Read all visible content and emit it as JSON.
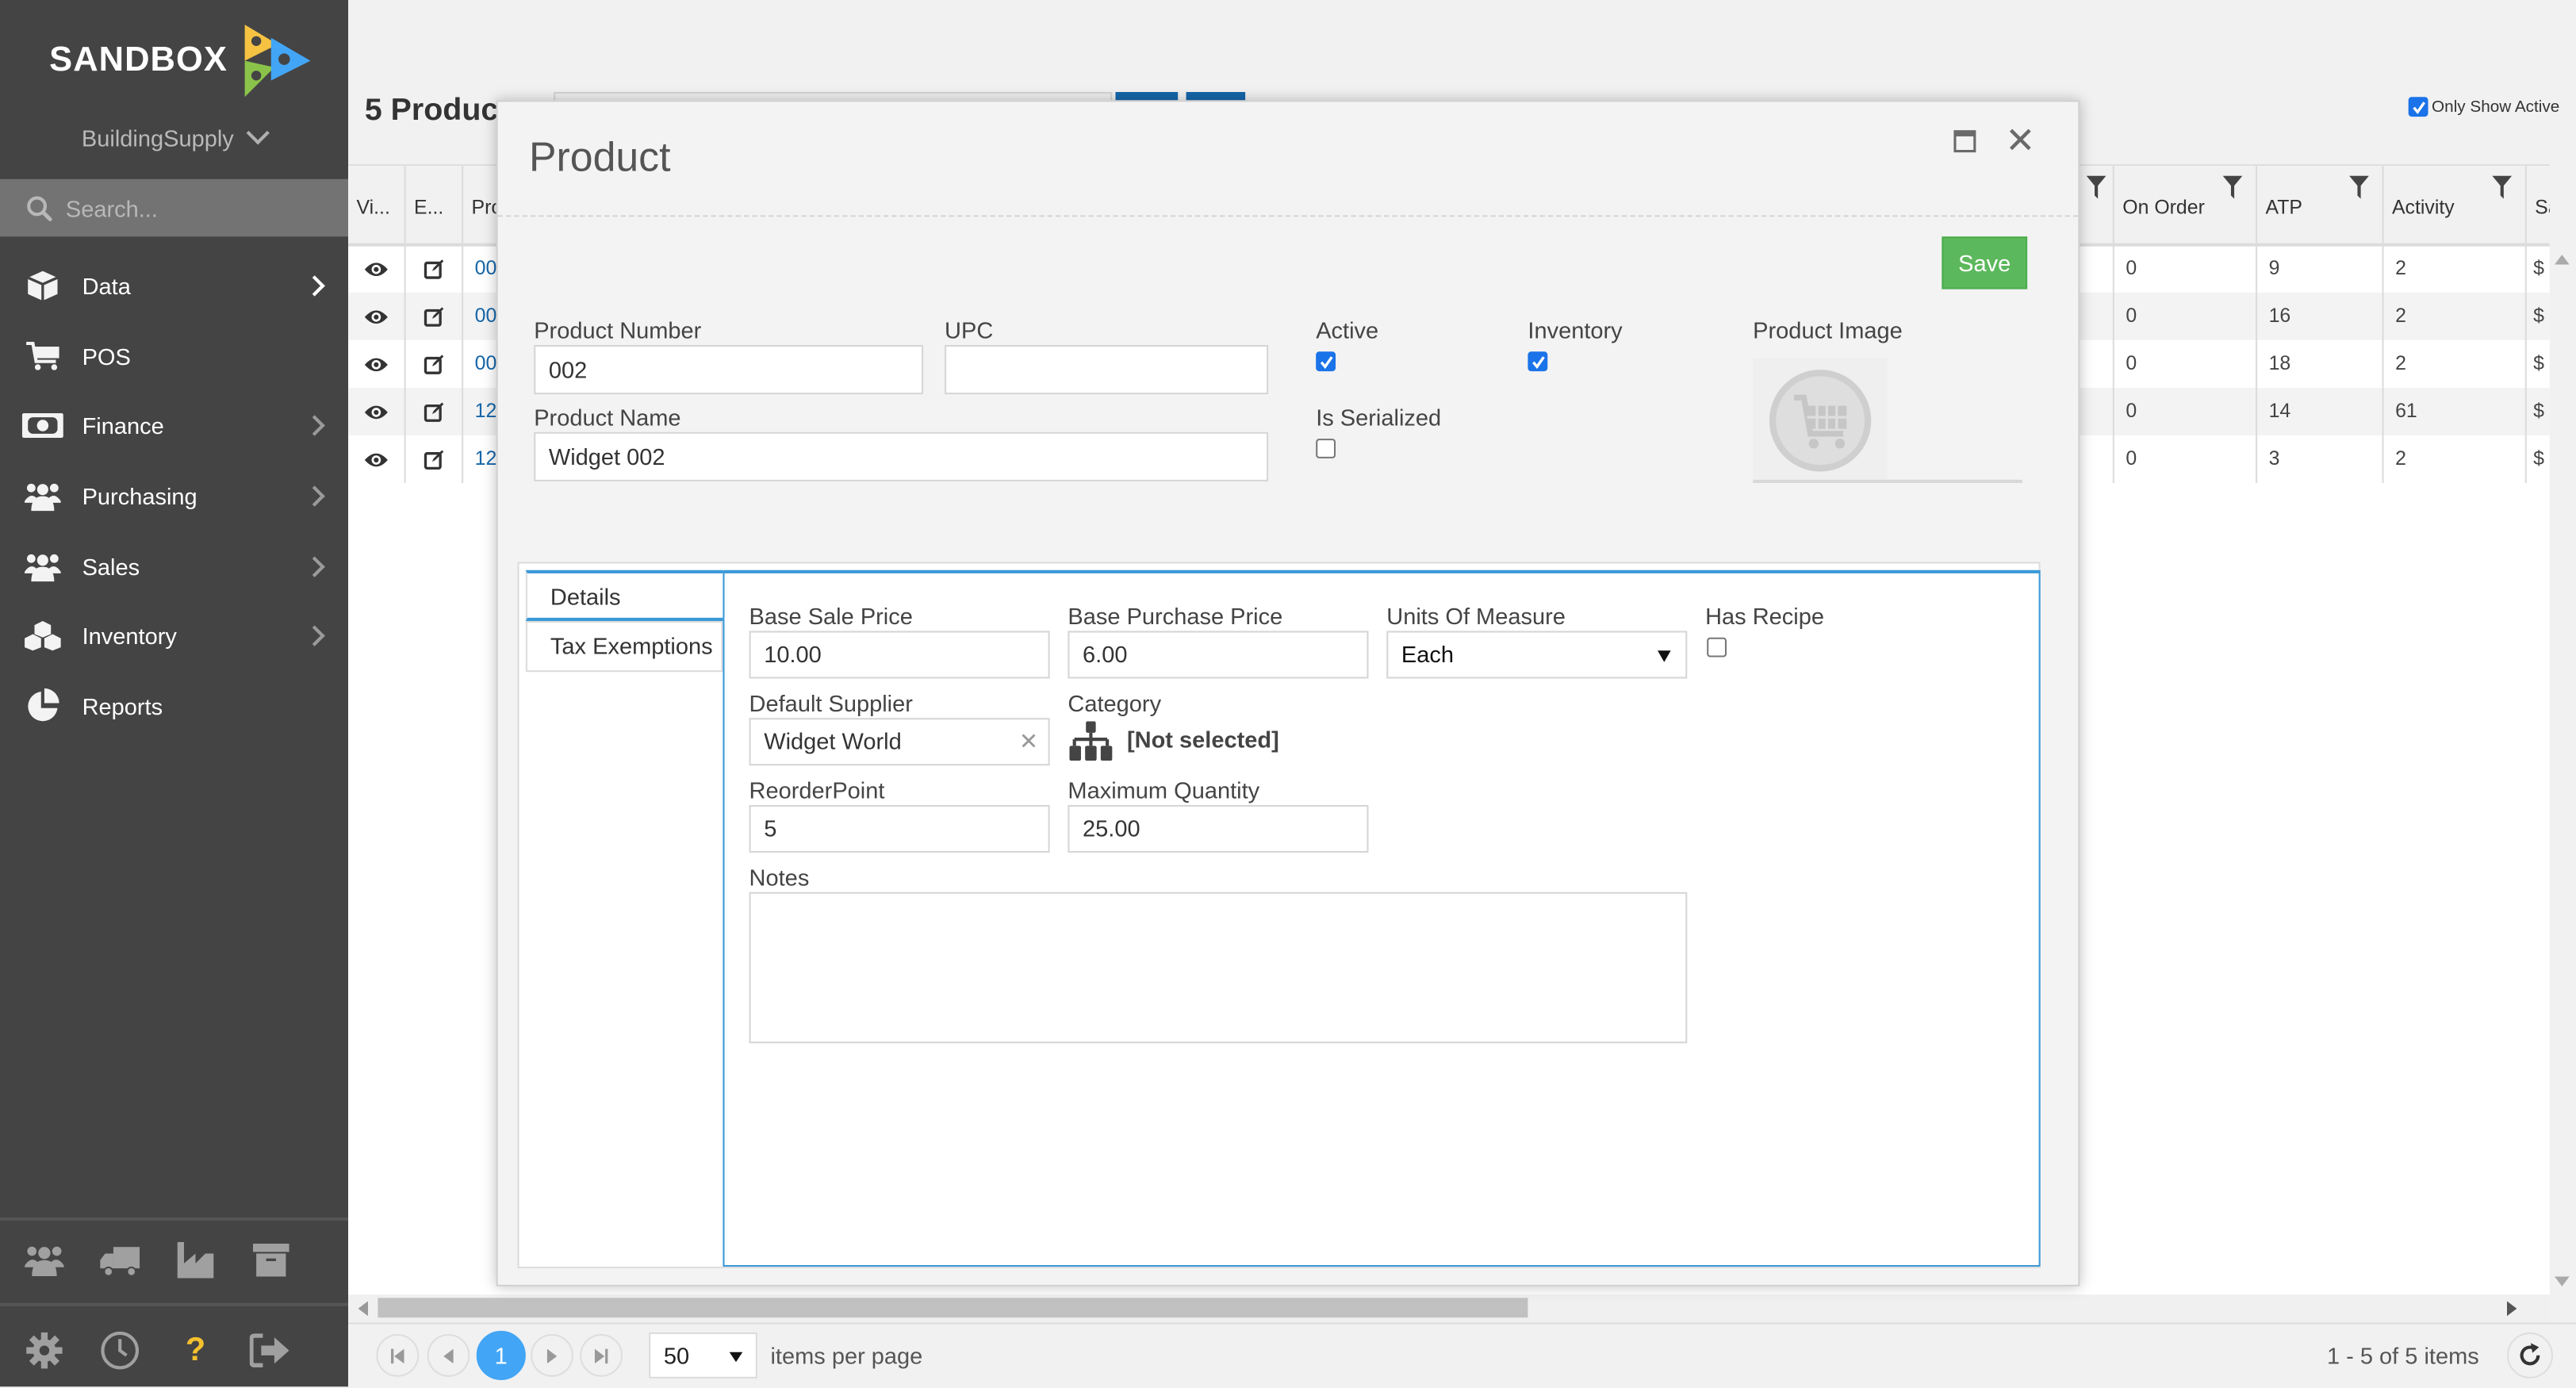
{
  "sidebar": {
    "brand": "SANDBOX",
    "company": "BuildingSupply",
    "search_placeholder": "Search...",
    "nav": [
      {
        "label": "Data",
        "icon": "cube-icon",
        "has_arrow": true
      },
      {
        "label": "POS",
        "icon": "cart-icon",
        "has_arrow": false
      },
      {
        "label": "Finance",
        "icon": "money-icon",
        "has_arrow": true
      },
      {
        "label": "Purchasing",
        "icon": "users-icon",
        "has_arrow": true
      },
      {
        "label": "Sales",
        "icon": "users-icon",
        "has_arrow": true
      },
      {
        "label": "Inventory",
        "icon": "cubes-icon",
        "has_arrow": true
      },
      {
        "label": "Reports",
        "icon": "pie-chart-icon",
        "has_arrow": false
      }
    ],
    "quick_icons": [
      "users-icon",
      "truck-icon",
      "factory-icon",
      "archive-icon"
    ],
    "footer_icons": [
      "gear-icon",
      "clock-icon",
      "help-icon",
      "logout-icon"
    ],
    "colors": {
      "bg": "#444444",
      "help": "#f5c12e"
    }
  },
  "main": {
    "page_title": "5 Produc",
    "only_show_active": {
      "label": "Only Show Active",
      "checked": true
    },
    "grid": {
      "columns_left": [
        "Vi...",
        "E...",
        "Pro"
      ],
      "columns_right": [
        "On Order",
        "ATP",
        "Activity",
        "Sa"
      ],
      "rows": [
        {
          "product": "00",
          "on_order": "0",
          "atp": "9",
          "activity": "2",
          "sa": "$"
        },
        {
          "product": "00",
          "on_order": "0",
          "atp": "16",
          "activity": "2",
          "sa": "$"
        },
        {
          "product": "00",
          "on_order": "0",
          "atp": "18",
          "activity": "2",
          "sa": "$"
        },
        {
          "product": "12",
          "on_order": "0",
          "atp": "14",
          "activity": "61",
          "sa": "$"
        },
        {
          "product": "12",
          "on_order": "0",
          "atp": "3",
          "activity": "2",
          "sa": "$"
        }
      ]
    },
    "pager": {
      "current_page": "1",
      "page_size": "50",
      "items_per_page_label": "items per page",
      "range_text": "1 - 5 of 5 items"
    }
  },
  "modal": {
    "title": "Product",
    "save_label": "Save",
    "fields": {
      "product_number": {
        "label": "Product Number",
        "value": "002"
      },
      "upc": {
        "label": "UPC",
        "value": ""
      },
      "product_name": {
        "label": "Product Name",
        "value": "Widget 002"
      },
      "active": {
        "label": "Active",
        "checked": true
      },
      "inventory": {
        "label": "Inventory",
        "checked": true
      },
      "is_serialized": {
        "label": "Is Serialized",
        "checked": false
      },
      "product_image": {
        "label": "Product Image"
      }
    },
    "tabs": [
      {
        "label": "Details",
        "active": true
      },
      {
        "label": "Tax Exemptions",
        "active": false
      }
    ],
    "details": {
      "base_sale_price": {
        "label": "Base Sale Price",
        "value": "10.00"
      },
      "base_purchase_price": {
        "label": "Base Purchase Price",
        "value": "6.00"
      },
      "units_of_measure": {
        "label": "Units Of Measure",
        "value": "Each"
      },
      "has_recipe": {
        "label": "Has Recipe",
        "checked": false
      },
      "default_supplier": {
        "label": "Default Supplier",
        "value": "Widget World"
      },
      "category": {
        "label": "Category",
        "value": "[Not selected]"
      },
      "reorder_point": {
        "label": "ReorderPoint",
        "value": "5"
      },
      "maximum_quantity": {
        "label": "Maximum Quantity",
        "value": "25.00"
      },
      "notes": {
        "label": "Notes",
        "value": ""
      }
    },
    "colors": {
      "save": "#5cb85c",
      "accent": "#3a99d8",
      "checkbox": "#1a73e8"
    }
  }
}
